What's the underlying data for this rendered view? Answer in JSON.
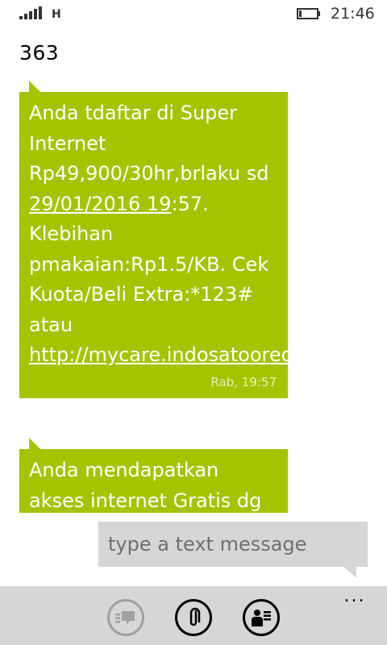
{
  "status_bar": {
    "network_type": "H",
    "time": "21:46",
    "signal_icon": "signal-bars-icon",
    "battery_icon": "battery-icon"
  },
  "thread": {
    "title": "363"
  },
  "messages": [
    {
      "text_parts": [
        "Anda tdaftar di Super Internet Rp49,900/30hr,brlaku sd ",
        "29/01/2016 19",
        ":57. Klebihan pmakaian:Rp1.5/KB. Cek Kuota/Beli Extra:*123# atau ",
        "http://mycare.indosatooredoo.com"
      ],
      "timestamp": "Rab, 19:57"
    },
    {
      "text_parts": [
        "Anda mendapatkan akses internet Gratis  dg"
      ],
      "timestamp": ""
    }
  ],
  "compose": {
    "placeholder": "type a text message",
    "value": ""
  },
  "app_bar": {
    "more_label": "...",
    "buttons": [
      {
        "icon": "send-icon"
      },
      {
        "icon": "attach-icon"
      },
      {
        "icon": "contact-card-icon"
      }
    ]
  },
  "colors": {
    "bubble": "#a4c400",
    "compose": "#d6d6d6",
    "app_bar": "#d6d6d6"
  }
}
